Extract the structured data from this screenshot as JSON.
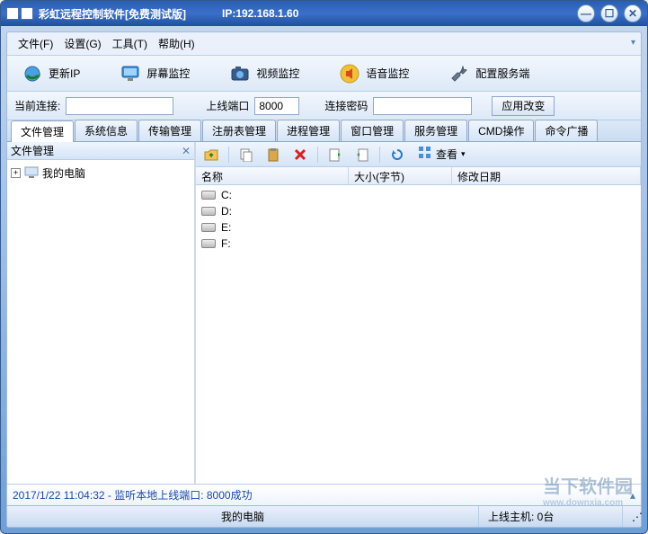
{
  "titlebar": {
    "title": "彩虹远程控制软件[免费测试版]",
    "ip_label": "IP:192.168.1.60"
  },
  "menu": {
    "file": "文件(F)",
    "settings": "设置(G)",
    "tools": "工具(T)",
    "help": "帮助(H)"
  },
  "toolbar": {
    "refresh_ip": "更新IP",
    "screen_monitor": "屏幕监控",
    "video_monitor": "视频监控",
    "audio_monitor": "语音监控",
    "config_server": "配置服务端"
  },
  "connection": {
    "current_label": "当前连接:",
    "current_value": "",
    "port_label": "上线端口",
    "port_value": "8000",
    "password_label": "连接密码",
    "password_value": "",
    "apply_btn": "应用改变"
  },
  "tabs": [
    "文件管理",
    "系统信息",
    "传输管理",
    "注册表管理",
    "进程管理",
    "窗口管理",
    "服务管理",
    "CMD操作",
    "命令广播"
  ],
  "active_tab_index": 0,
  "sidebar": {
    "header": "文件管理",
    "root_node": "我的电脑"
  },
  "file_toolbar": {
    "view_label": "查看"
  },
  "columns": {
    "name": "名称",
    "size": "大小(字节)",
    "modified": "修改日期"
  },
  "drives": [
    "C:",
    "D:",
    "E:",
    "F:"
  ],
  "log": {
    "text": "2017/1/22 11:04:32 - 监听本地上线端口: 8000成功"
  },
  "statusbar": {
    "path": "我的电脑",
    "hosts": "上线主机: 0台"
  },
  "watermark": {
    "main": "当下软件园",
    "sub": "www.downxia.com"
  }
}
